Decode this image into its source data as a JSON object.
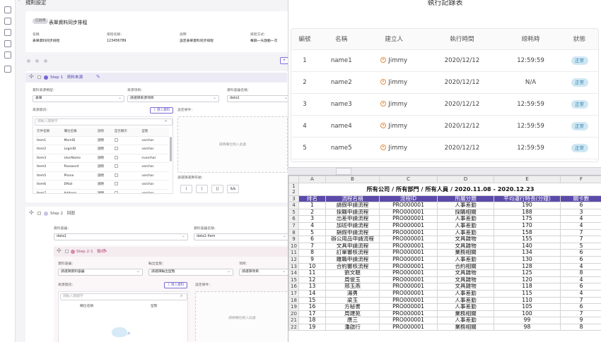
{
  "rule_page": {
    "title": "規則設定",
    "badge": "已啟用",
    "rule_name": "表單資料同步排程",
    "meta": [
      {
        "label": "名稱",
        "value": "表單資料同步排程"
      },
      {
        "label": "排程名稱：",
        "value": "123456789"
      },
      {
        "label": "說明",
        "value": "設定表單資料同步排程"
      },
      {
        "label": "排程方式：",
        "value": "每隔一天啟動一次"
      }
    ],
    "step1": {
      "title": "Step 1　資料來源",
      "source_type_label": "資料來源類型：",
      "source_type_value": "表單",
      "source_item_label": "來源項目：",
      "source_item_value": "請選擇來源項目",
      "container_label": "資料容器名稱：",
      "container_value": "data1",
      "source_fields_label": "來源資訊：",
      "import_button": "匯入資料",
      "search_placeholder": "請輸入關鍵字",
      "condition_label": "設定條件：",
      "drop_hint": "請將欄位拖入此處",
      "sort_label": "請選擇運算符號：",
      "columns": [
        "元件名稱",
        "欄位名稱",
        "說明",
        "是否顯示",
        "型態"
      ],
      "rows": [
        [
          "Item1",
          "MemID",
          "說明",
          "varchar"
        ],
        [
          "Item2",
          "LoginID",
          "說明",
          "varchar"
        ],
        [
          "Item3",
          "UserName",
          "說明",
          "nvarchar"
        ],
        [
          "Item4",
          "Password",
          "說明",
          "varchar"
        ],
        [
          "Item5",
          "Phone",
          "說明",
          "varchar"
        ],
        [
          "Item6",
          "EMail",
          "說明",
          "varchar"
        ],
        [
          "Item7",
          "Address",
          "說明",
          "varchar"
        ],
        [
          "Item8",
          "Account",
          "說明",
          "varchar"
        ]
      ],
      "operators": [
        "(",
        ")",
        "||",
        "&&"
      ]
    },
    "step2": {
      "title": "Step 2　回圈",
      "container_label": "資料容器：",
      "container_value": "data1",
      "container_name_label": "資料容器名稱：",
      "container_name_value": "data1-item"
    },
    "step21": {
      "title": "Step 2-1　輸出",
      "container_label": "資料容器：",
      "container_value": "請選擇資料容器",
      "output_type_label": "輸出型態：",
      "output_type_value": "請選擇輸出型態",
      "project_label": "項目：",
      "project_value": "請選擇項目",
      "source_fields_label": "來源資訊：",
      "import_button": "匯入資料",
      "search_placeholder": "請輸入關鍵字",
      "condition_label": "設定條件：",
      "columns": [
        "欄位名稱",
        "型態"
      ],
      "drop_hint": "請將欄位拖入此處"
    }
  },
  "exec_log": {
    "title": "執行記錄表",
    "columns": [
      "編號",
      "名稱",
      "建立人",
      "執行時間",
      "總耗時",
      "狀態"
    ],
    "rows": [
      {
        "id": "1",
        "name": "name1",
        "creator": "Jimmy",
        "time": "2020/12/12",
        "duration": "12:59:59",
        "status": "正常"
      },
      {
        "id": "2",
        "name": "name2",
        "creator": "Jimmy",
        "time": "2020/12/12",
        "duration": "N/A",
        "status": "正常"
      },
      {
        "id": "3",
        "name": "name3",
        "creator": "Jimmy",
        "time": "2020/12/12",
        "duration": "12:59:59",
        "status": "正常"
      },
      {
        "id": "4",
        "name": "name4",
        "creator": "Jimmy",
        "time": "2020/12/12",
        "duration": "12:59:59",
        "status": "正常"
      },
      {
        "id": "5",
        "name": "name5",
        "creator": "Jimmy",
        "time": "2020/12/12",
        "duration": "12:59:59",
        "status": "正常"
      }
    ]
  },
  "spreadsheet": {
    "col_letters": [
      "A",
      "B",
      "C",
      "D",
      "E",
      "F"
    ],
    "title": "所有公司 / 所有部門 / 所有人員 / 2020.11.08 - 2020.12.23",
    "headers": [
      "排名",
      "流程名稱",
      "流程ID",
      "所屬分類",
      "平均運行時長(分鐘)",
      "關卡數"
    ],
    "rows": [
      [
        "1",
        "請假申請流程",
        "PRO000001",
        "人事差勤",
        "190",
        "6"
      ],
      [
        "2",
        "採購申請流程",
        "PRO000001",
        "採購相關",
        "188",
        "3"
      ],
      [
        "3",
        "出差申請流程",
        "PRO000001",
        "人事差勤",
        "175",
        "4"
      ],
      [
        "4",
        "加班申請流程",
        "PRO000001",
        "人事差勤",
        "170",
        "4"
      ],
      [
        "5",
        "銷假申請流程",
        "PRO000001",
        "人事差勤",
        "158",
        "7"
      ],
      [
        "6",
        "辦公用品申請流程",
        "PRO000001",
        "文具雜物",
        "155",
        "7"
      ],
      [
        "7",
        "文具申請流程",
        "PRO000001",
        "文具雜物",
        "140",
        "5"
      ],
      [
        "8",
        "訂單審核流程",
        "PRO000001",
        "業務相關",
        "134",
        "6"
      ],
      [
        "9",
        "離職申請流程",
        "PRO000001",
        "人事差勤",
        "130",
        "6"
      ],
      [
        "10",
        "合約審核流程",
        "PRO000001",
        "合約相關",
        "128",
        "4"
      ],
      [
        "11",
        "劉文聰",
        "PRO000001",
        "文具雜物",
        "125",
        "8"
      ],
      [
        "12",
        "周俊玉",
        "PRO000001",
        "文具雜物",
        "120",
        "4"
      ],
      [
        "13",
        "邢玉燕",
        "PRO000001",
        "文具雜物",
        "118",
        "6"
      ],
      [
        "14",
        "湯勇",
        "PRO000001",
        "人事差勤",
        "115",
        "4"
      ],
      [
        "15",
        "梁玉",
        "PRO000001",
        "人事差勤",
        "110",
        "7"
      ],
      [
        "16",
        "方秘書",
        "PRO000001",
        "人事差勤",
        "105",
        "6"
      ],
      [
        "17",
        "周建苑",
        "PRO000001",
        "業務相關",
        "100",
        "7"
      ],
      [
        "18",
        "唐三",
        "PRO000001",
        "人事差勤",
        "99",
        "9"
      ],
      [
        "19",
        "潘啟行",
        "PRO000001",
        "業務相關",
        "98",
        "8"
      ]
    ]
  }
}
